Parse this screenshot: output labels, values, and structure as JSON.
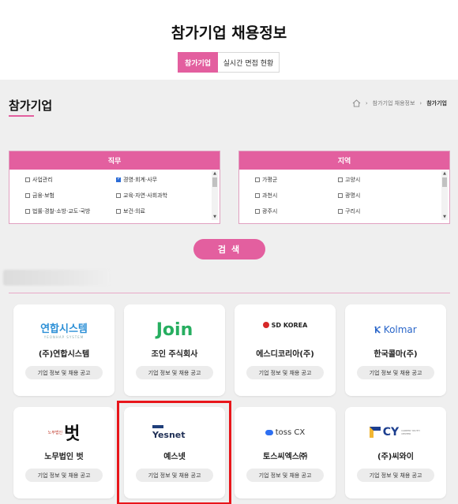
{
  "header": {
    "title": "참가기업 채용정보",
    "tabs": [
      {
        "label": "참가기업",
        "active": true
      },
      {
        "label": "실시간 면접 현황",
        "active": false
      }
    ]
  },
  "section": {
    "title": "참가기업",
    "breadcrumb": [
      "참가기업 채용정보",
      "참가기업"
    ]
  },
  "filters": {
    "job": {
      "title": "직무",
      "options": [
        {
          "label": "사업관리",
          "checked": false
        },
        {
          "label": "경영·회계·사무",
          "checked": true
        },
        {
          "label": "금융·보험",
          "checked": false
        },
        {
          "label": "교육·자연·사회과학",
          "checked": false
        },
        {
          "label": "법률·경찰·소방·교도·국방",
          "checked": false
        },
        {
          "label": "보건·의료",
          "checked": false
        }
      ]
    },
    "region": {
      "title": "지역",
      "options": [
        {
          "label": "가평군",
          "checked": false
        },
        {
          "label": "고양시",
          "checked": false
        },
        {
          "label": "과천시",
          "checked": false
        },
        {
          "label": "광명시",
          "checked": false
        },
        {
          "label": "광주시",
          "checked": false
        },
        {
          "label": "구리시",
          "checked": false
        }
      ]
    }
  },
  "search_label": "검 색",
  "companies": [
    {
      "name": "(주)연합시스템",
      "logo": "연합시스템",
      "logo_sub": "YEONHAP SYSTEM",
      "button": "기업 정보 및 채용 공고"
    },
    {
      "name": "조인 주식회사",
      "logo": "Join",
      "button": "기업 정보 및 채용 공고"
    },
    {
      "name": "에스디코리아(주)",
      "logo": "SD KOREA",
      "button": "기업 정보 및 채용 공고"
    },
    {
      "name": "한국콜마(주)",
      "logo": "Kolmar",
      "button": "기업 정보 및 채용 공고"
    },
    {
      "name": "노무법인 벗",
      "logo": "벗",
      "logo_sub": "노무법인",
      "button": "기업 정보 및 채용 공고"
    },
    {
      "name": "예스넷",
      "logo": "Yesnet",
      "button": "기업 정보 및 채용 공고"
    },
    {
      "name": "토스씨엑스㈜",
      "logo": "toss CX",
      "button": "기업 정보 및 채용 공고"
    },
    {
      "name": "(주)씨와이",
      "logo": "CY",
      "logo_sub": "CAREER YOUTH CENTER",
      "button": "기업 정보 및 채용 공고"
    }
  ],
  "colors": {
    "accent": "#e35f9f",
    "highlight": "#e8161b",
    "background": "#efefef"
  }
}
